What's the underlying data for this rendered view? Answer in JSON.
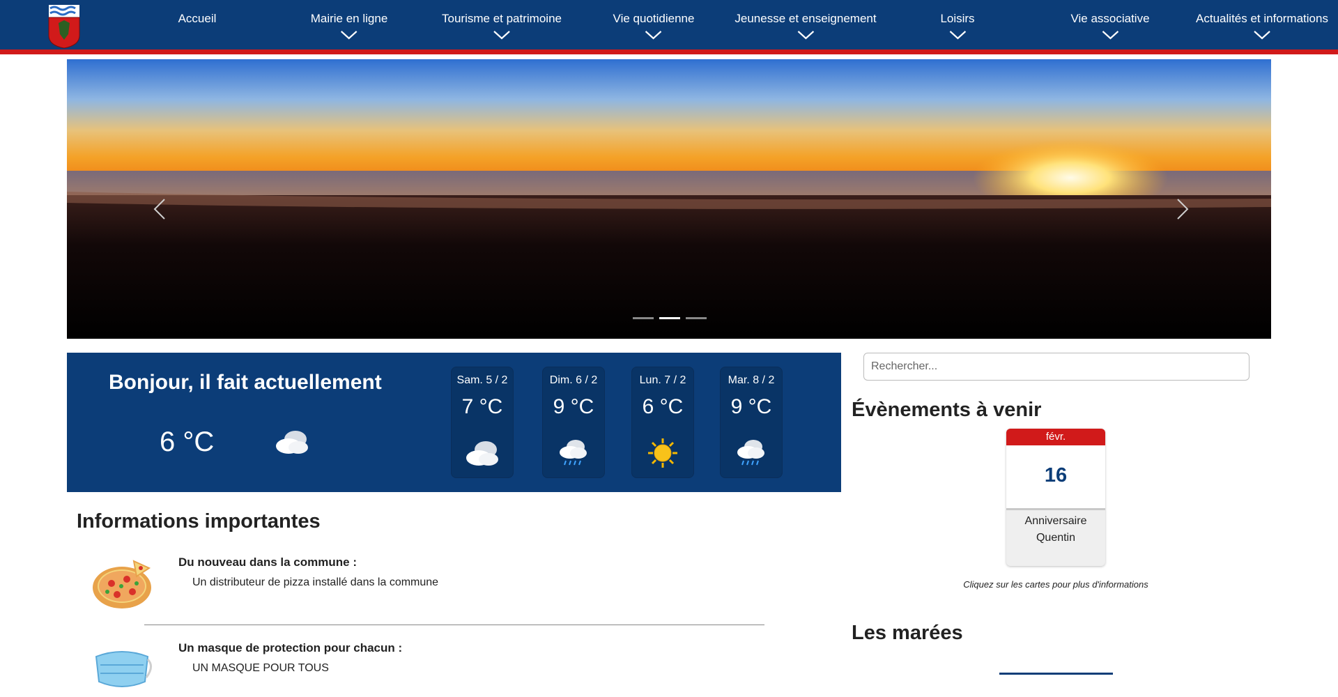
{
  "nav": {
    "logo_icon": "coat-of-arms-icon",
    "items": [
      {
        "label": "Accueil",
        "dropdown": false
      },
      {
        "label": "Mairie en ligne",
        "dropdown": true
      },
      {
        "label": "Tourisme et patrimoine",
        "dropdown": true
      },
      {
        "label": "Vie quotidienne",
        "dropdown": true
      },
      {
        "label": "Jeunesse et enseignement",
        "dropdown": true
      },
      {
        "label": "Loisirs",
        "dropdown": true
      },
      {
        "label": "Vie associative",
        "dropdown": true
      },
      {
        "label": "Actualités et informations",
        "dropdown": true
      }
    ]
  },
  "carousel": {
    "slide_count": 3,
    "active_index": 1,
    "prev_icon": "chevron-left-icon",
    "next_icon": "chevron-right-icon"
  },
  "weather": {
    "greeting": "Bonjour, il fait actuellement",
    "current_temp": "6 °C",
    "current_icon": "cloudy-icon",
    "forecast": [
      {
        "day": "Sam. 5 / 2",
        "temp": "7 °C",
        "icon": "cloudy-icon"
      },
      {
        "day": "Dim. 6 / 2",
        "temp": "9 °C",
        "icon": "rain-icon"
      },
      {
        "day": "Lun. 7 / 2",
        "temp": "6 °C",
        "icon": "sun-icon"
      },
      {
        "day": "Mar. 8 / 2",
        "temp": "9 °C",
        "icon": "rain-icon"
      }
    ]
  },
  "search": {
    "placeholder": "Rechercher..."
  },
  "events": {
    "title": "Évènements à venir",
    "card": {
      "month": "févr.",
      "day": "16",
      "name": "Anniversaire Quentin"
    },
    "hint": "Cliquez sur les cartes pour plus d'informations"
  },
  "tides": {
    "title": "Les marées"
  },
  "info": {
    "title": "Informations importantes",
    "items": [
      {
        "icon": "pizza-icon",
        "heading": "Du nouveau dans la commune :",
        "text": "Un distributeur de pizza installé dans la commune"
      },
      {
        "icon": "face-mask-icon",
        "heading": "Un masque de protection pour chacun :",
        "text": "UN MASQUE POUR TOUS"
      }
    ]
  },
  "colors": {
    "primary": "#0c3d78",
    "accent": "#d11a1a"
  }
}
